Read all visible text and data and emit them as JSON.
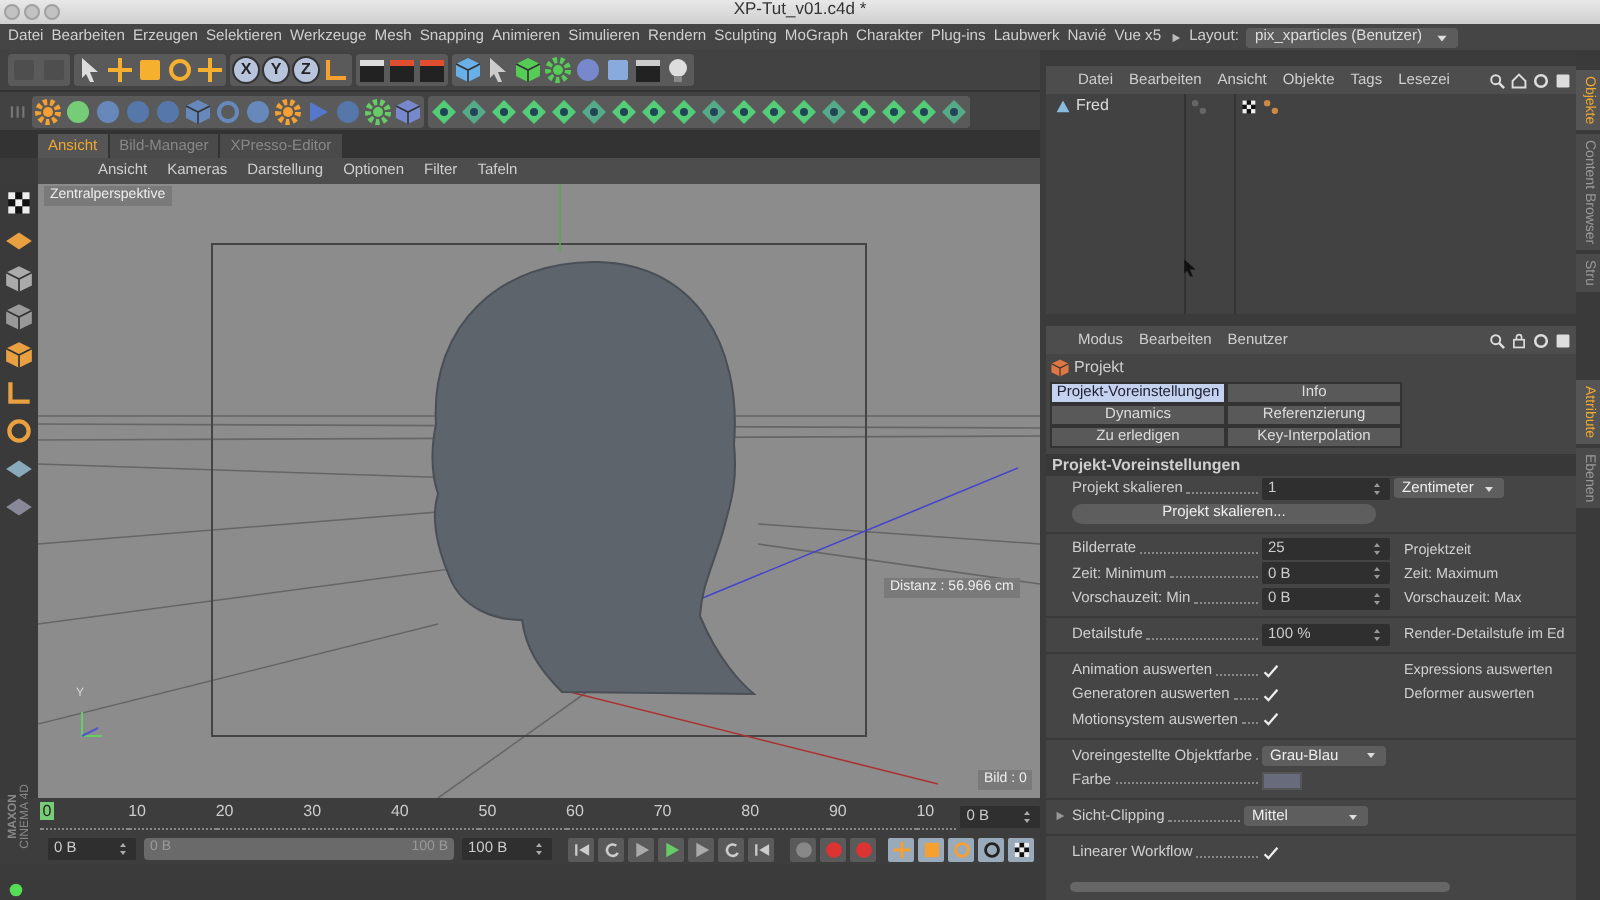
{
  "window": {
    "title": "XP-Tut_v01.c4d *"
  },
  "menu_bar": {
    "items": [
      "Datei",
      "Bearbeiten",
      "Erzeugen",
      "Selektieren",
      "Werkzeuge",
      "Mesh",
      "Snapping",
      "Animieren",
      "Simulieren",
      "Rendern",
      "Sculpting",
      "MoGraph",
      "Charakter",
      "Plug-ins",
      "Laubwerk",
      "Navié",
      "Vue x5"
    ],
    "layout_label": "Layout:",
    "layout_value": "pix_xparticles (Benutzer)"
  },
  "axis_buttons": [
    "X",
    "Y",
    "Z"
  ],
  "view_tabs": [
    {
      "label": "Ansicht",
      "selected": true
    },
    {
      "label": "Bild-Manager",
      "selected": false
    },
    {
      "label": "XPresso-Editor",
      "selected": false
    }
  ],
  "view_menu": [
    "Ansicht",
    "Kameras",
    "Darstellung",
    "Optionen",
    "Filter",
    "Tafeln"
  ],
  "viewport": {
    "projection": "Zentralperspektive",
    "distance": "Distanz : 56.966 cm",
    "frame": "Bild : 0",
    "axis_label": "Y"
  },
  "timeline": {
    "ticks": [
      "0",
      "10",
      "20",
      "30",
      "40",
      "50",
      "60",
      "70",
      "80",
      "90",
      "10"
    ],
    "current_frame": "0 B",
    "start": "0 B",
    "range_start": "0 B",
    "range_end": "100 B",
    "level": 1,
    "end": "100 B"
  },
  "branding": [
    "MAXON",
    "CINEMA 4D"
  ],
  "object_manager": {
    "menu": [
      "Datei",
      "Bearbeiten",
      "Ansicht",
      "Objekte",
      "Tags",
      "Lesezei"
    ],
    "objects": [
      {
        "name": "Fred"
      }
    ]
  },
  "attribute_manager": {
    "menu": [
      "Modus",
      "Bearbeiten",
      "Benutzer"
    ],
    "title": "Projekt",
    "tabs": [
      {
        "label": "Projekt-Voreinstellungen",
        "selected": true
      },
      {
        "label": "Info",
        "selected": false
      },
      {
        "label": "Dynamics",
        "selected": false
      },
      {
        "label": "Referenzierung",
        "selected": false
      },
      {
        "label": "Zu erledigen",
        "selected": false
      },
      {
        "label": "Key-Interpolation",
        "selected": false
      }
    ],
    "section": "Projekt-Voreinstellungen",
    "rows": [
      {
        "kind": "field",
        "label": "Projekt skalieren",
        "value": "1",
        "unit": "Zentimeter"
      },
      {
        "kind": "button",
        "label": "Projekt skalieren..."
      },
      {
        "kind": "field",
        "label": "Bilderrate",
        "value": "25",
        "right_label": "Projektzeit",
        "divider": true
      },
      {
        "kind": "field",
        "label": "Zeit: Minimum",
        "value": "0 B",
        "right_label": "Zeit: Maximum"
      },
      {
        "kind": "field",
        "label": "Vorschauzeit: Min",
        "value": "0 B",
        "right_label": "Vorschauzeit: Max"
      },
      {
        "kind": "field",
        "label": "Detailstufe",
        "value": "100 %",
        "right_label": "Render-Detailstufe im Ed",
        "divider": true
      },
      {
        "kind": "check",
        "label": "Animation auswerten",
        "checked": true,
        "right_label": "Expressions auswerten",
        "divider": true
      },
      {
        "kind": "check",
        "label": "Generatoren auswerten",
        "checked": true,
        "right_label": "Deformer auswerten"
      },
      {
        "kind": "check",
        "label": "Motionsystem auswerten",
        "checked": true
      },
      {
        "kind": "dropdown",
        "label": "Voreingestellte Objektfarbe",
        "value": "Grau-Blau",
        "divider": true
      },
      {
        "kind": "color",
        "label": "Farbe",
        "color": "#676b7c"
      },
      {
        "kind": "dropdown",
        "label": "Sicht-Clipping",
        "value": "Mittel",
        "expanded": false,
        "divider": true
      },
      {
        "kind": "check",
        "label": "Linearer Workflow",
        "checked": true,
        "divider": true
      }
    ]
  },
  "side_tabs": [
    {
      "label": "Objekte",
      "selected": true
    },
    {
      "label": "Content Browser",
      "selected": false
    },
    {
      "label": "Stru",
      "selected": false
    }
  ],
  "side_tabs_lower": [
    {
      "label": "Attribute",
      "selected": true
    },
    {
      "label": "Ebenen",
      "selected": false
    }
  ]
}
